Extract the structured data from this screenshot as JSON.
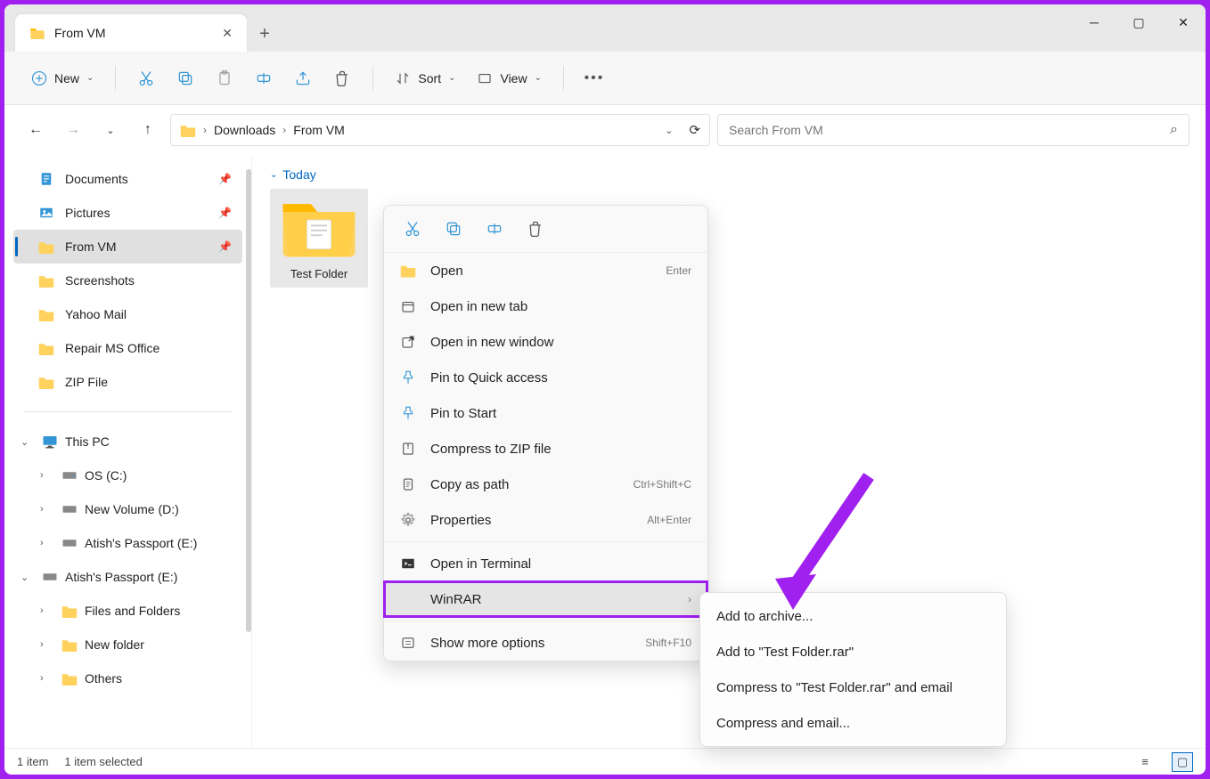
{
  "tab": {
    "title": "From VM"
  },
  "toolbar": {
    "new_label": "New",
    "sort_label": "Sort",
    "view_label": "View"
  },
  "breadcrumbs": [
    "Downloads",
    "From VM"
  ],
  "search": {
    "placeholder": "Search From VM"
  },
  "sidebar": {
    "pinned": [
      {
        "label": "Documents"
      },
      {
        "label": "Pictures"
      },
      {
        "label": "From VM"
      },
      {
        "label": "Screenshots"
      },
      {
        "label": "Yahoo Mail"
      },
      {
        "label": "Repair MS Office"
      },
      {
        "label": "ZIP File"
      }
    ],
    "this_pc_label": "This PC",
    "drives": [
      {
        "label": "OS (C:)"
      },
      {
        "label": "New Volume (D:)"
      },
      {
        "label": "Atish's Passport  (E:)"
      }
    ],
    "passport_label": "Atish's Passport  (E:)",
    "passport_children": [
      {
        "label": "Files and Folders"
      },
      {
        "label": "New folder"
      },
      {
        "label": "Others"
      }
    ]
  },
  "content": {
    "group_label": "Today",
    "item_name": "Test Folder"
  },
  "context_menu": {
    "open": "Open",
    "open_shortcut": "Enter",
    "open_tab": "Open in new tab",
    "open_window": "Open in new window",
    "pin_quick": "Pin to Quick access",
    "pin_start": "Pin to Start",
    "compress_zip": "Compress to ZIP file",
    "copy_path": "Copy as path",
    "copy_path_shortcut": "Ctrl+Shift+C",
    "properties": "Properties",
    "properties_shortcut": "Alt+Enter",
    "terminal": "Open in Terminal",
    "winrar": "WinRAR",
    "more": "Show more options",
    "more_shortcut": "Shift+F10"
  },
  "submenu": {
    "add_archive": "Add to archive...",
    "add_named": "Add to \"Test Folder.rar\"",
    "compress_email": "Compress to \"Test Folder.rar\" and email",
    "compress_email2": "Compress and email..."
  },
  "status": {
    "count": "1 item",
    "selected": "1 item selected"
  }
}
